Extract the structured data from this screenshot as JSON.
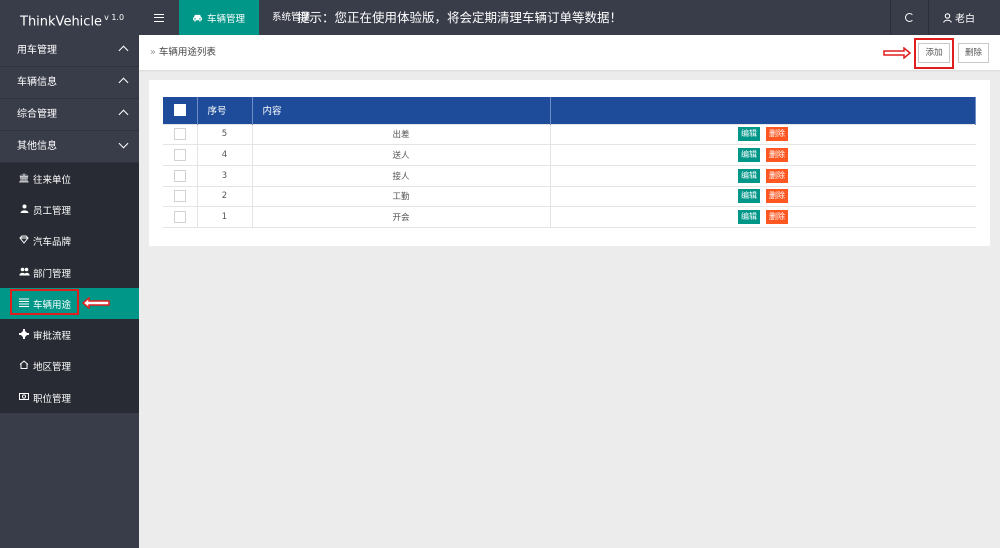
{
  "app": {
    "brand": "ThinkVehicle",
    "version": "v 1.0"
  },
  "topbar": {
    "active_tab": "车辆管理",
    "system_tab": "系统管理",
    "notice": "提示：您正在使用体验版，将会定期清理车辆订单等数据！",
    "user": "老白"
  },
  "sidebar": {
    "groups": [
      {
        "label": "用车管理",
        "state": "collapsed-up"
      },
      {
        "label": "车辆信息",
        "state": "collapsed-up"
      },
      {
        "label": "综合管理",
        "state": "collapsed-up"
      },
      {
        "label": "其他信息",
        "state": "expanded"
      }
    ],
    "items": [
      {
        "label": "往来单位",
        "icon": "bank-icon"
      },
      {
        "label": "员工管理",
        "icon": "user-icon"
      },
      {
        "label": "汽车品牌",
        "icon": "diamond-icon"
      },
      {
        "label": "部门管理",
        "icon": "users-icon"
      },
      {
        "label": "车辆用途",
        "icon": "list-icon",
        "active": true
      },
      {
        "label": "审批流程",
        "icon": "workflow-icon"
      },
      {
        "label": "地区管理",
        "icon": "home-icon"
      },
      {
        "label": "职位管理",
        "icon": "camera-icon"
      }
    ]
  },
  "content": {
    "breadcrumb": "车辆用途列表",
    "add_button": "添加",
    "delete_button": "删除",
    "table": {
      "headers": {
        "index": "序号",
        "content": "内容"
      },
      "rows": [
        {
          "index": "5",
          "content": "出差"
        },
        {
          "index": "4",
          "content": "送人"
        },
        {
          "index": "3",
          "content": "接人"
        },
        {
          "index": "2",
          "content": "工勤"
        },
        {
          "index": "1",
          "content": "开会"
        }
      ],
      "edit_label": "编辑",
      "remove_label": "删除"
    }
  },
  "colors": {
    "topbar": "#393d49",
    "accent": "#009688",
    "table_header": "#1e4c9a",
    "danger": "#ff5722",
    "annotation": "#e01e1e"
  }
}
